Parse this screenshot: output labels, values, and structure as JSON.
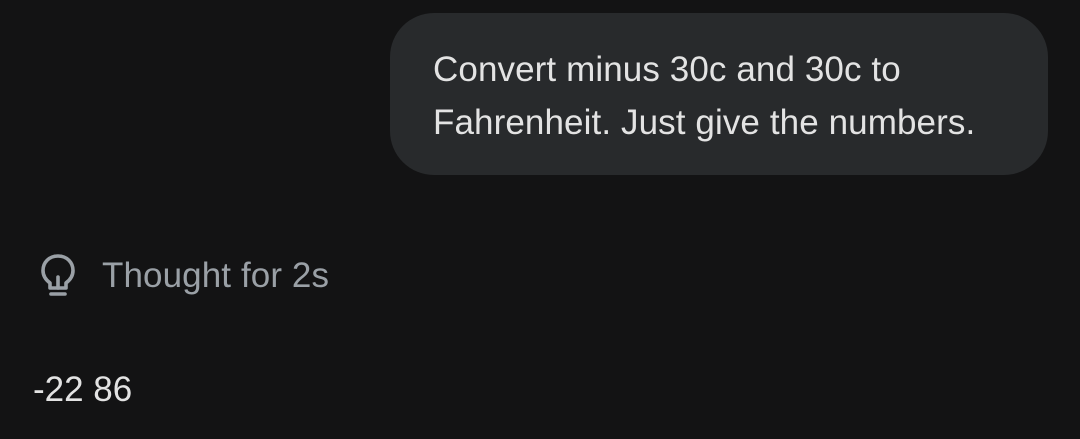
{
  "conversation": {
    "user_message": "Convert minus 30c and 30c to Fahrenheit. Just give the numbers.",
    "thought": {
      "icon": "lightbulb-icon",
      "label": "Thought for 2s"
    },
    "model_reply": "-22 86"
  },
  "colors": {
    "background": "#131314",
    "bubble": "#282a2c",
    "primary_text": "#e3e3e3",
    "muted_text": "#9aa0a6"
  }
}
